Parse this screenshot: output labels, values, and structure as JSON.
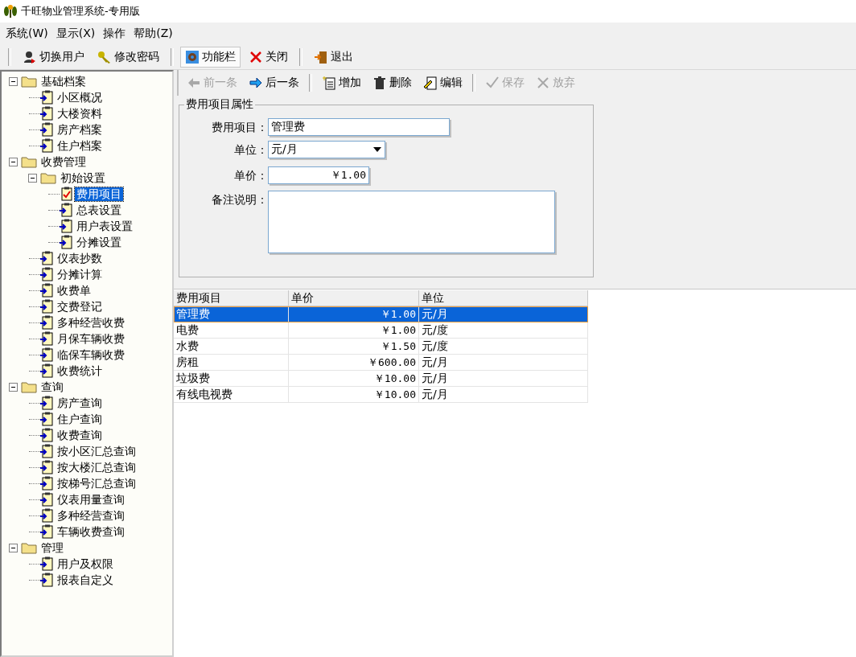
{
  "window": {
    "title": "千旺物业管理系统-专用版"
  },
  "menu": [
    {
      "label": "系统(W)"
    },
    {
      "label": "显示(X)"
    },
    {
      "label": "操作"
    },
    {
      "label": "帮助(Z)"
    }
  ],
  "toolbar": [
    {
      "label": "切换用户",
      "selected": false
    },
    {
      "label": "修改密码",
      "selected": false
    },
    {
      "label": "功能栏",
      "selected": true
    },
    {
      "label": "关闭",
      "selected": false
    },
    {
      "label": "退出",
      "selected": false
    }
  ],
  "tree": [
    {
      "label": "基础档案",
      "expanded": true,
      "selected": false,
      "children": [
        {
          "label": "小区概况",
          "selected": false
        },
        {
          "label": "大楼资料",
          "selected": false
        },
        {
          "label": "房产档案",
          "selected": false
        },
        {
          "label": "住户档案",
          "selected": false
        }
      ]
    },
    {
      "label": "收费管理",
      "expanded": true,
      "selected": false,
      "children": [
        {
          "label": "初始设置",
          "expanded": true,
          "selected": false,
          "children": [
            {
              "label": "费用项目",
              "selected": true
            },
            {
              "label": "总表设置",
              "selected": false
            },
            {
              "label": "用户表设置",
              "selected": false
            },
            {
              "label": "分摊设置",
              "selected": false
            }
          ]
        },
        {
          "label": "仪表抄数",
          "selected": false
        },
        {
          "label": "分摊计算",
          "selected": false
        },
        {
          "label": "收费单",
          "selected": false
        },
        {
          "label": "交费登记",
          "selected": false
        },
        {
          "label": "多种经营收费",
          "selected": false
        },
        {
          "label": "月保车辆收费",
          "selected": false
        },
        {
          "label": "临保车辆收费",
          "selected": false
        },
        {
          "label": "收费统计",
          "selected": false
        }
      ]
    },
    {
      "label": "查询",
      "expanded": true,
      "selected": false,
      "children": [
        {
          "label": "房产查询",
          "selected": false
        },
        {
          "label": "住户查询",
          "selected": false
        },
        {
          "label": "收费查询",
          "selected": false
        },
        {
          "label": "按小区汇总查询",
          "selected": false
        },
        {
          "label": "按大楼汇总查询",
          "selected": false
        },
        {
          "label": "按梯号汇总查询",
          "selected": false
        },
        {
          "label": "仪表用量查询",
          "selected": false
        },
        {
          "label": "多种经营查询",
          "selected": false
        },
        {
          "label": "车辆收费查询",
          "selected": false
        }
      ]
    },
    {
      "label": "管理",
      "expanded": true,
      "selected": false,
      "children": [
        {
          "label": "用户及权限",
          "selected": false
        },
        {
          "label": "报表自定义",
          "selected": false
        }
      ]
    }
  ],
  "actions": [
    {
      "label": "前一条",
      "disabled": true
    },
    {
      "label": "后一条",
      "disabled": false
    },
    {
      "label": "增加",
      "disabled": false
    },
    {
      "label": "删除",
      "disabled": false
    },
    {
      "label": "编辑",
      "disabled": false
    },
    {
      "label": "保存",
      "disabled": true
    },
    {
      "label": "放弃",
      "disabled": true
    }
  ],
  "form": {
    "title": "费用项目属性",
    "fields": [
      {
        "label": "费用项目：",
        "kind": "text",
        "value": "管理费"
      },
      {
        "label": "单位：",
        "kind": "select",
        "value": "元/月"
      },
      {
        "label": "单价：",
        "kind": "money",
        "value": "￥1.00"
      },
      {
        "label": "备注说明：",
        "kind": "memo"
      }
    ]
  },
  "table": {
    "columns": [
      "费用项目",
      "单价",
      "单位"
    ],
    "rows": [
      {
        "cells": [
          "管理费",
          "￥1.00",
          "元/月"
        ],
        "selected": true
      },
      {
        "cells": [
          "电费",
          "￥1.00",
          "元/度"
        ],
        "selected": false
      },
      {
        "cells": [
          "水费",
          "￥1.50",
          "元/度"
        ],
        "selected": false
      },
      {
        "cells": [
          "房租",
          "￥600.00",
          "元/月"
        ],
        "selected": false
      },
      {
        "cells": [
          "垃圾费",
          "￥10.00",
          "元/月"
        ],
        "selected": false
      },
      {
        "cells": [
          "有线电视费",
          "￥10.00",
          "元/月"
        ],
        "selected": false
      }
    ]
  }
}
